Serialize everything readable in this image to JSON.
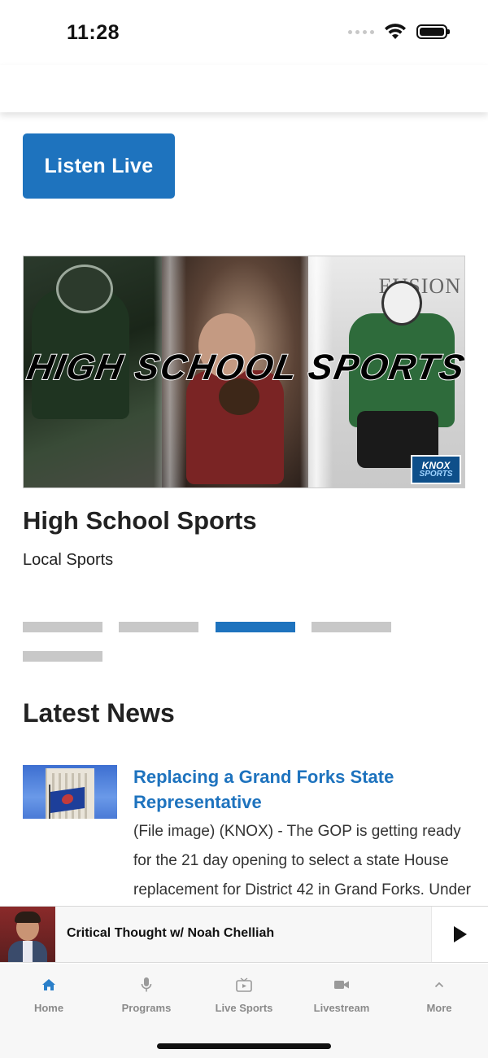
{
  "status_bar": {
    "time": "11:28",
    "icons": [
      "cellular-signal-icon",
      "wifi-icon",
      "battery-icon"
    ]
  },
  "listen_live": {
    "label": "Listen Live"
  },
  "featured": {
    "image_caption": "HIGH SCHOOL SPORTS",
    "image_background_text": "EUSION",
    "logo_line1": "KNOX",
    "logo_line2": "SPORTS",
    "title": "High School Sports",
    "category": "Local Sports"
  },
  "carousel": {
    "count": 5,
    "active_index": 2,
    "active_color": "#1e73be",
    "inactive_color": "#c8c8c8"
  },
  "latest_news": {
    "heading": "Latest News",
    "items": [
      {
        "title": "Replacing a Grand Forks State Representative",
        "excerpt": "(File image) (KNOX) - The GOP is getting ready for the 21 day opening to select a state House replacement for District 42 in Grand Forks. Under"
      }
    ]
  },
  "mini_player": {
    "title": "Critical Thought w/ Noah Chelliah",
    "action": "play-icon"
  },
  "tab_bar": {
    "tabs": [
      {
        "label": "Home",
        "icon": "home-icon",
        "active": true
      },
      {
        "label": "Programs",
        "icon": "microphone-icon",
        "active": false
      },
      {
        "label": "Live Sports",
        "icon": "tv-play-icon",
        "active": false
      },
      {
        "label": "Livestream",
        "icon": "video-camera-icon",
        "active": false
      },
      {
        "label": "More",
        "icon": "chevron-up-icon",
        "active": false
      }
    ]
  },
  "colors": {
    "accent": "#1e73be",
    "active_tab_icon": "#2a7fc9",
    "inactive_tab": "#8a8a8a"
  }
}
